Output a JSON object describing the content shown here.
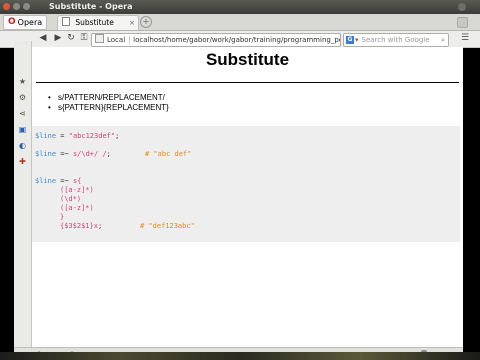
{
  "window": {
    "title": "Substitute - Opera"
  },
  "tabbar": {
    "opera_label": "Opera",
    "tab_title": "Substitute",
    "tab_close": "×",
    "new_tab": "+"
  },
  "toolbar": {
    "back": "◀",
    "forward": "▶",
    "reload": "↻",
    "key": "⚿",
    "url_local_label": "Local",
    "url": "localhost/home/gabor/work/gabor/training/programming_per",
    "search_engine": "G",
    "search_dd": "▾",
    "search_placeholder": "Search with Google",
    "search_icon": "⌕",
    "menu": "☰"
  },
  "sidebar": {
    "items": [
      "★",
      "⚙",
      "⋖",
      "▣",
      "◐",
      "✚"
    ]
  },
  "page": {
    "title": "Substitute",
    "bullets": [
      "s/PATTERN/REPLACEMENT/",
      "s{PATTERN}{REPLACEMENT}"
    ],
    "code": {
      "l1_var": "$line",
      "l1_op": " = ",
      "l1_str": "\"abc123def\"",
      "l1_end": ";",
      "l2_var": "$line",
      "l2_op": " =~ ",
      "l2_str": "s/\\d+/ /",
      "l2_end": ";",
      "l2_com": "# \"abc def\"",
      "l3_var": "$line",
      "l3_op": " =~ ",
      "l3_str": "s{",
      "l4": "([a-z]*)",
      "l5": "(\\d*)",
      "l6": "([a-z]*)",
      "l7": "}",
      "l8_str": "{$3$2$1}x",
      "l8_end": ";",
      "l8_com": "# \"def123abc\""
    }
  },
  "statusbar": {
    "icons": [
      "◐",
      "☁",
      "◎"
    ],
    "view_icon": "▭"
  }
}
